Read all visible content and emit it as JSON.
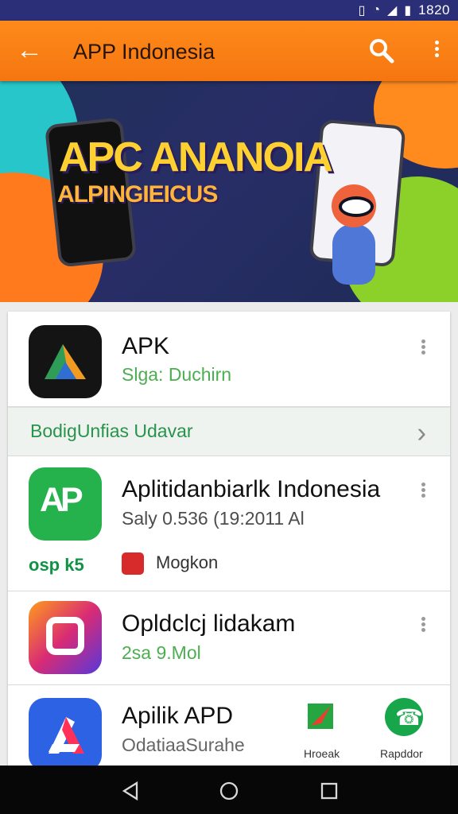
{
  "status_bar": {
    "time": "1820"
  },
  "toolbar": {
    "title": "APP Indonesia"
  },
  "banner": {
    "title": "APC ANANOIA",
    "subtitle": "ALPINGIEICUS"
  },
  "apps": [
    {
      "name": "APK",
      "meta": "Slga: Duchirn"
    },
    {
      "name": "Aplitidanbiarlk Indonesia",
      "meta": "Saly 0.536 (19:2011 Al"
    },
    {
      "name": "Opldclcj lidakam",
      "meta": "2sa 9.Mol"
    },
    {
      "name": "Apilik APD",
      "meta": "OdatiaaSurahe"
    }
  ],
  "update_banner": {
    "label": "BodigUnfias Udavar"
  },
  "tags": {
    "left": "osp k5",
    "right": "Mogkon"
  },
  "bottom_actions": [
    {
      "label": "Hroeak"
    },
    {
      "label": "Rapddor"
    }
  ],
  "icons": {
    "wifi": "wifi-icon",
    "signal": "signal-icon",
    "battery": "battery-icon",
    "search": "search-icon",
    "overflow": "more-vert-icon",
    "back": "arrow-back-icon",
    "nav_back": "triangle-back-icon",
    "nav_home": "circle-home-icon",
    "nav_recent": "square-recent-icon"
  },
  "colors": {
    "toolbar": "#f57611",
    "status_bar": "#2a2f77",
    "accent_green": "#27944a"
  }
}
